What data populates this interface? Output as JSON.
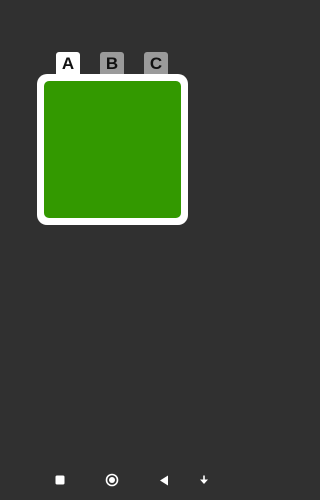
{
  "tabs": [
    {
      "label": "A",
      "selected": true
    },
    {
      "label": "B",
      "selected": false
    },
    {
      "label": "C",
      "selected": false
    }
  ],
  "panel": {
    "color": "#339900"
  },
  "colors": {
    "background": "#303030",
    "tab_selected": "#ffffff",
    "tab_unselected": "#9a9a9a",
    "nav_icons": "#ffffff"
  },
  "navbar": {
    "icons": [
      "recents-icon",
      "home-icon",
      "back-icon",
      "keyboard-hide-icon"
    ]
  }
}
